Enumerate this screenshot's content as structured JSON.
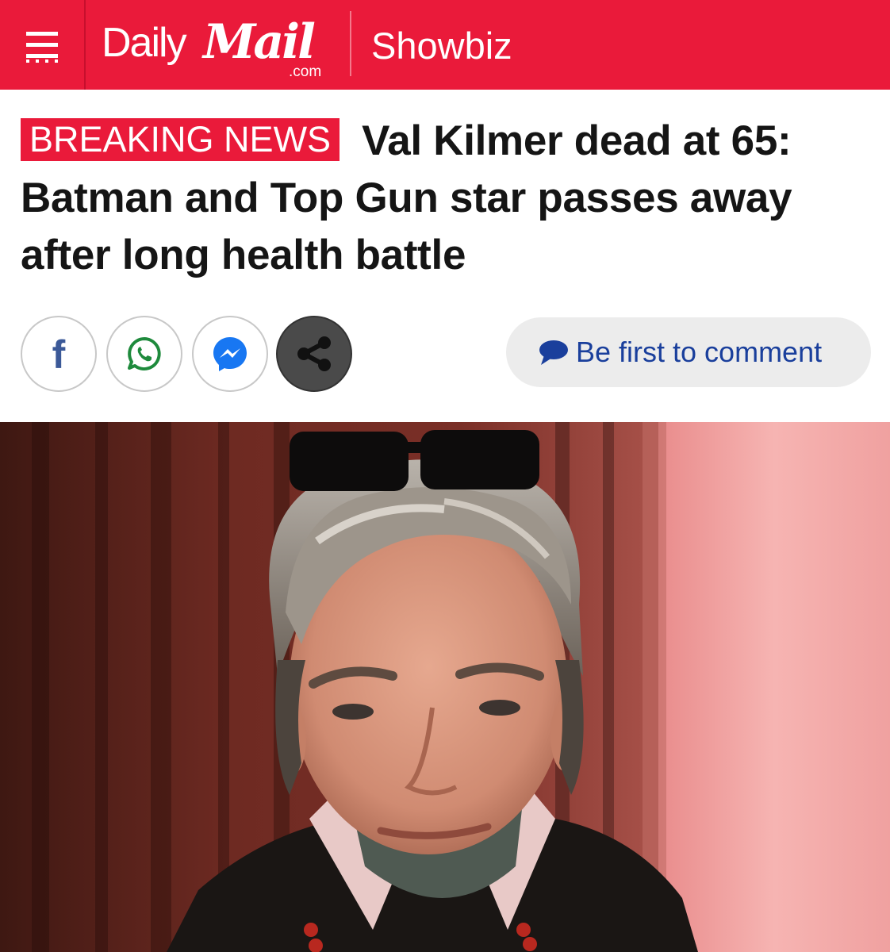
{
  "header": {
    "brand_daily": "Daily",
    "brand_mail": "Mail",
    "brand_domain": ".com",
    "section": "Showbiz",
    "menu_icon": "hamburger-menu-icon",
    "brand_color": "#ea1a3a"
  },
  "article": {
    "badge": "BREAKING NEWS",
    "title": "Val Kilmer dead at 65: Batman and Top Gun star passes away after long health battle"
  },
  "share": {
    "icons": [
      "facebook-icon",
      "whatsapp-icon",
      "messenger-icon",
      "share-icon"
    ],
    "comment_label": "Be first to comment",
    "comment_color": "#1a3f9c"
  }
}
